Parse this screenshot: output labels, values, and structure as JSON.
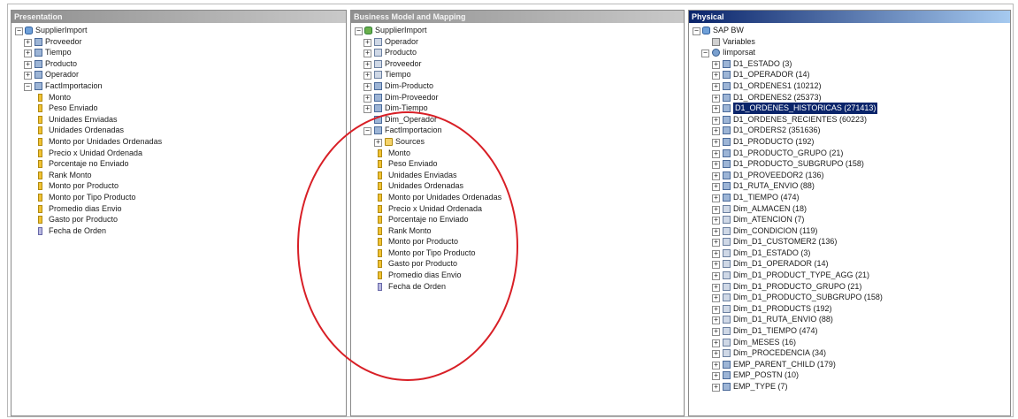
{
  "panes": {
    "presentation": {
      "title": "Presentation",
      "root": "SupplierImport",
      "items": [
        {
          "label": "Proveedor",
          "icon": "table",
          "indent": 1,
          "expander": "+"
        },
        {
          "label": "Tiempo",
          "icon": "table",
          "indent": 1,
          "expander": "+"
        },
        {
          "label": "Producto",
          "icon": "table",
          "indent": 1,
          "expander": "+"
        },
        {
          "label": "Operador",
          "icon": "table",
          "indent": 1,
          "expander": "+"
        },
        {
          "label": "FactImportacion",
          "icon": "table",
          "indent": 1,
          "expander": "-"
        },
        {
          "label": "Monto",
          "icon": "field",
          "indent": 2
        },
        {
          "label": "Peso Enviado",
          "icon": "field",
          "indent": 2
        },
        {
          "label": "Unidades Enviadas",
          "icon": "field",
          "indent": 2
        },
        {
          "label": "Unidades Ordenadas",
          "icon": "field",
          "indent": 2
        },
        {
          "label": "Monto por Unidades Ordenadas",
          "icon": "field",
          "indent": 2
        },
        {
          "label": "Precio x Unidad Ordenada",
          "icon": "field",
          "indent": 2
        },
        {
          "label": "Porcentaje no Enviado",
          "icon": "field",
          "indent": 2
        },
        {
          "label": "Rank Monto",
          "icon": "field",
          "indent": 2
        },
        {
          "label": "Monto por Producto",
          "icon": "field",
          "indent": 2
        },
        {
          "label": "Monto por Tipo Producto",
          "icon": "field",
          "indent": 2
        },
        {
          "label": "Promedio dias Envio",
          "icon": "field",
          "indent": 2
        },
        {
          "label": "Gasto por Producto",
          "icon": "field",
          "indent": 2
        },
        {
          "label": "Fecha de Orden",
          "icon": "calendar",
          "indent": 2
        }
      ]
    },
    "business": {
      "title": "Business Model and Mapping",
      "root": "SupplierImport",
      "items": [
        {
          "label": "Operador",
          "icon": "dimension",
          "indent": 1,
          "expander": "+"
        },
        {
          "label": "Producto",
          "icon": "dimension",
          "indent": 1,
          "expander": "+"
        },
        {
          "label": "Proveedor",
          "icon": "dimension",
          "indent": 1,
          "expander": "+"
        },
        {
          "label": "Tiempo",
          "icon": "dimension",
          "indent": 1,
          "expander": "+"
        },
        {
          "label": "Dim-Producto",
          "icon": "table",
          "indent": 1,
          "expander": "+"
        },
        {
          "label": "Dim-Proveedor",
          "icon": "table",
          "indent": 1,
          "expander": "+"
        },
        {
          "label": "Dim-Tiempo",
          "icon": "table",
          "indent": 1,
          "expander": "+"
        },
        {
          "label": "Dim_Operador",
          "icon": "table",
          "indent": 1,
          "expander": ""
        },
        {
          "label": "FactImportacion",
          "icon": "table",
          "indent": 1,
          "expander": "-"
        },
        {
          "label": "Sources",
          "icon": "folder",
          "indent": 2,
          "expander": "+"
        },
        {
          "label": "Monto",
          "icon": "field",
          "indent": 2
        },
        {
          "label": "Peso Enviado",
          "icon": "field",
          "indent": 2
        },
        {
          "label": "Unidades Enviadas",
          "icon": "field",
          "indent": 2
        },
        {
          "label": "Unidades Ordenadas",
          "icon": "field",
          "indent": 2
        },
        {
          "label": "Monto por Unidades Ordenadas",
          "icon": "field",
          "indent": 2
        },
        {
          "label": "Precio x Unidad Ordenada",
          "icon": "field",
          "indent": 2
        },
        {
          "label": "Porcentaje no Enviado",
          "icon": "field",
          "indent": 2
        },
        {
          "label": "Rank Monto",
          "icon": "field",
          "indent": 2
        },
        {
          "label": "Monto por Producto",
          "icon": "field",
          "indent": 2
        },
        {
          "label": "Monto por Tipo Producto",
          "icon": "field",
          "indent": 2
        },
        {
          "label": "Gasto por Producto",
          "icon": "field",
          "indent": 2
        },
        {
          "label": "Promedio dias Envio",
          "icon": "field",
          "indent": 2
        },
        {
          "label": "Fecha de Orden",
          "icon": "calendar",
          "indent": 2
        }
      ]
    },
    "physical": {
      "title": "Physical",
      "root": "SAP BW",
      "items": [
        {
          "label": "Variables",
          "icon": "key",
          "indent": 1,
          "expander": ""
        },
        {
          "label": "Iimporsat",
          "icon": "user",
          "indent": 1,
          "expander": "-"
        },
        {
          "label": "D1_ESTADO (3)",
          "icon": "table",
          "indent": 2,
          "expander": "+"
        },
        {
          "label": "D1_OPERADOR (14)",
          "icon": "table",
          "indent": 2,
          "expander": "+"
        },
        {
          "label": "D1_ORDENES1 (10212)",
          "icon": "table",
          "indent": 2,
          "expander": "+"
        },
        {
          "label": "D1_ORDENES2 (25373)",
          "icon": "table",
          "indent": 2,
          "expander": "+"
        },
        {
          "label": "D1_ORDENES_HISTORICAS (271413)",
          "icon": "table",
          "indent": 2,
          "expander": "+",
          "selected": true
        },
        {
          "label": "D1_ORDENES_RECIENTES (60223)",
          "icon": "table",
          "indent": 2,
          "expander": "+"
        },
        {
          "label": "D1_ORDERS2 (351636)",
          "icon": "table",
          "indent": 2,
          "expander": "+"
        },
        {
          "label": "D1_PRODUCTO (192)",
          "icon": "table",
          "indent": 2,
          "expander": "+"
        },
        {
          "label": "D1_PRODUCTO_GRUPO (21)",
          "icon": "table",
          "indent": 2,
          "expander": "+"
        },
        {
          "label": "D1_PRODUCTO_SUBGRUPO (158)",
          "icon": "table",
          "indent": 2,
          "expander": "+"
        },
        {
          "label": "D1_PROVEEDOR2 (136)",
          "icon": "table",
          "indent": 2,
          "expander": "+"
        },
        {
          "label": "D1_RUTA_ENVIO (88)",
          "icon": "table",
          "indent": 2,
          "expander": "+"
        },
        {
          "label": "D1_TIEMPO (474)",
          "icon": "table",
          "indent": 2,
          "expander": "+"
        },
        {
          "label": "Dim_ALMACEN (18)",
          "icon": "dimension",
          "indent": 2,
          "expander": "+"
        },
        {
          "label": "Dim_ATENCION (7)",
          "icon": "dimension",
          "indent": 2,
          "expander": "+"
        },
        {
          "label": "Dim_CONDICION (119)",
          "icon": "dimension",
          "indent": 2,
          "expander": "+"
        },
        {
          "label": "Dim_D1_CUSTOMER2 (136)",
          "icon": "dimension",
          "indent": 2,
          "expander": "+"
        },
        {
          "label": "Dim_D1_ESTADO (3)",
          "icon": "dimension",
          "indent": 2,
          "expander": "+"
        },
        {
          "label": "Dim_D1_OPERADOR (14)",
          "icon": "dimension",
          "indent": 2,
          "expander": "+"
        },
        {
          "label": "Dim_D1_PRODUCT_TYPE_AGG (21)",
          "icon": "dimension",
          "indent": 2,
          "expander": "+"
        },
        {
          "label": "Dim_D1_PRODUCTO_GRUPO (21)",
          "icon": "dimension",
          "indent": 2,
          "expander": "+"
        },
        {
          "label": "Dim_D1_PRODUCTO_SUBGRUPO (158)",
          "icon": "dimension",
          "indent": 2,
          "expander": "+"
        },
        {
          "label": "Dim_D1_PRODUCTS (192)",
          "icon": "dimension",
          "indent": 2,
          "expander": "+"
        },
        {
          "label": "Dim_D1_RUTA_ENVIO (88)",
          "icon": "dimension",
          "indent": 2,
          "expander": "+"
        },
        {
          "label": "Dim_D1_TIEMPO (474)",
          "icon": "dimension",
          "indent": 2,
          "expander": "+"
        },
        {
          "label": "Dim_MESES (16)",
          "icon": "dimension",
          "indent": 2,
          "expander": "+"
        },
        {
          "label": "Dim_PROCEDENCIA (34)",
          "icon": "dimension",
          "indent": 2,
          "expander": "+"
        },
        {
          "label": "EMP_PARENT_CHILD (179)",
          "icon": "table",
          "indent": 2,
          "expander": "+"
        },
        {
          "label": "EMP_POSTN (10)",
          "icon": "table",
          "indent": 2,
          "expander": "+"
        },
        {
          "label": "EMP_TYPE (7)",
          "icon": "table",
          "indent": 2,
          "expander": "+"
        }
      ]
    }
  },
  "colors": {
    "highlight_ellipse": "#d81f26",
    "selection": "#0a246a"
  }
}
